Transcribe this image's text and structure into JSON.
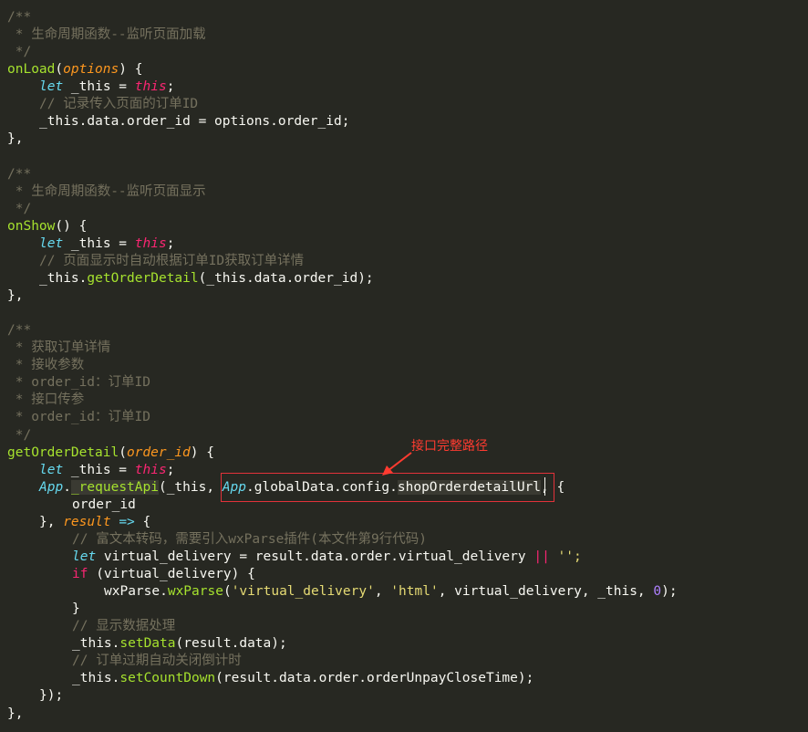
{
  "annotation": {
    "label": "接口完整路径",
    "color": "#e2323a"
  },
  "code": {
    "c1_open": "/**",
    "c1_text": " * 生命周期函数--监听页面加载",
    "c1_close": " */",
    "onload_name": "onLoad",
    "onload_param": "options",
    "l_let": "let",
    "l_this_var": " _this = ",
    "l_this_kw": "this",
    "l_semi": ";",
    "onload_comment": "// 记录传入页面的订单ID",
    "onload_assign": "_this.data.order_id = options.order_id;",
    "close_brace_comma": "},",
    "c2_open": "/**",
    "c2_text": " * 生命周期函数--监听页面显示",
    "c2_close": " */",
    "onshow_name": "onShow",
    "onshow_comment": "// 页面显示时自动根据订单ID获取订单详情",
    "onshow_call_prefix": "_this.",
    "onshow_call_fn": "getOrderDetail",
    "onshow_call_args": "(_this.data.order_id);",
    "c3_open": "/**",
    "c3_l1": " * 获取订单详情",
    "c3_l2": " * 接收参数",
    "c3_l3": " * order_id：订单ID",
    "c3_l4": " * 接口传参",
    "c3_l5": " * order_id：订单ID",
    "c3_close": " */",
    "god_name": "getOrderDetail",
    "god_param": "order_id",
    "api_app": "App",
    "api_dot": ".",
    "api_fn": "_requestApi",
    "api_args_a": "(_this, ",
    "api_cfg": ".globalData.config.",
    "api_url": "shopOrderdetailUrl",
    "api_tail": ", {",
    "api_order_id": "order_id",
    "api_close": "}, ",
    "api_result": "result",
    "api_arrow": " => ",
    "api_brace": "{",
    "cb_c1": "// 富文本转码，需要引入wxParse插件(本文件第9行代码)",
    "cb_let": "let",
    "cb_vd": " virtual_delivery = result.data.order.virtual_delivery ",
    "cb_or": "||",
    "cb_empty": " '';",
    "cb_if": "if",
    "cb_if_cond": " (virtual_delivery) {",
    "wx_obj": "wxParse.",
    "wx_fn": "wxParse",
    "wx_open": "(",
    "wx_s1": "'virtual_delivery'",
    "wx_sep1": ", ",
    "wx_s2": "'html'",
    "wx_mid": ", virtual_delivery, _this, ",
    "wx_zero": "0",
    "wx_close": ");",
    "cb_rbrace": "}",
    "cb_c2": "// 显示数据处理",
    "cb_sd_prefix": "_this.",
    "cb_sd_fn": "setData",
    "cb_sd_args": "(result.data);",
    "cb_c3": "// 订单过期自动关闭倒计时",
    "cb_cd_prefix": "_this.",
    "cb_cd_fn": "setCountDown",
    "cb_cd_args": "(result.data.order.orderUnpayCloseTime);",
    "end_call": "});",
    "end_fn": "},",
    "paren_open_close": "() {",
    "paren_open": "(",
    "paren_close_brace": ") {"
  }
}
